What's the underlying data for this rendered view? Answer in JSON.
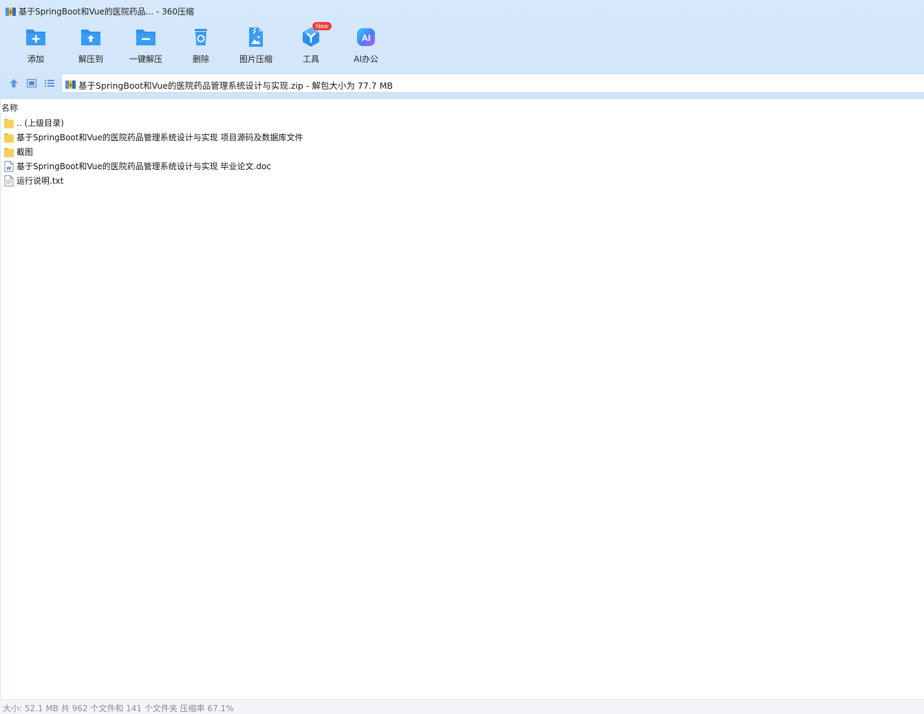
{
  "window": {
    "title": "基于SpringBoot和Vue的医院药品... - 360压缩",
    "app_icon": "archive-app-icon"
  },
  "toolbar": {
    "items": [
      {
        "label": "添加",
        "icon": "add-folder-icon"
      },
      {
        "label": "解压到",
        "icon": "extract-to-icon"
      },
      {
        "label": "一键解压",
        "icon": "quick-extract-icon"
      },
      {
        "label": "删除",
        "icon": "recycle-bin-icon"
      },
      {
        "label": "图片压缩",
        "icon": "image-compress-icon"
      },
      {
        "label": "工具",
        "icon": "tools-cube-icon",
        "badge": "New"
      },
      {
        "label": "AI办公",
        "icon": "ai-office-icon"
      }
    ]
  },
  "navbar": {
    "address": "基于SpringBoot和Vue的医院药品管理系统设计与实现.zip - 解包大小为 77.7 MB"
  },
  "list": {
    "column_name": "名称",
    "rows": [
      {
        "name": ".. (上级目录)",
        "type": "folder"
      },
      {
        "name": "基于SpringBoot和Vue的医院药品管理系统设计与实现 项目源码及数据库文件",
        "type": "folder"
      },
      {
        "name": "截图",
        "type": "folder"
      },
      {
        "name": "基于SpringBoot和Vue的医院药品管理系统设计与实现 毕业论文.doc",
        "type": "word"
      },
      {
        "name": "运行说明.txt",
        "type": "text"
      }
    ]
  },
  "status": {
    "text": "大小: 52.1 MB 共 962 个文件和 141 个文件夹 压缩率 67.1%"
  },
  "colors": {
    "header_bg": "#d6e8fb",
    "icon_blue": "#2c8ff0",
    "badge_red": "#ef3b3b",
    "folder_yellow": "#f7cf5f"
  }
}
